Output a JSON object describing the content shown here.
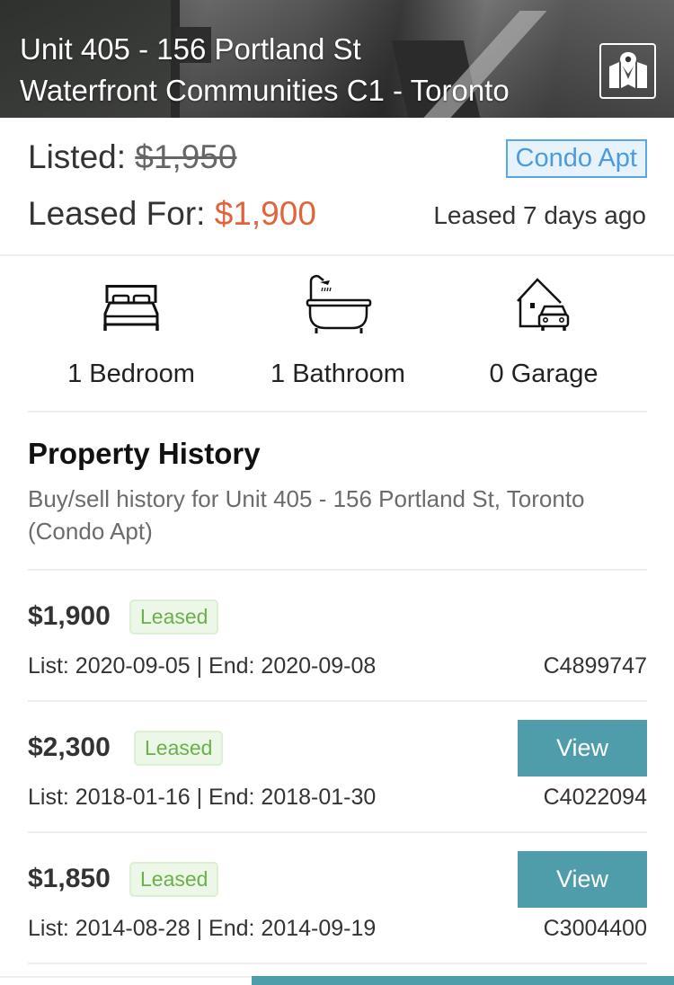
{
  "header": {
    "address_line": "Unit 405 - 156 Portland St",
    "community_line": "Waterfront Communities C1 - Toronto",
    "map_icon": "map-pin-icon"
  },
  "pricing": {
    "listed_label": "Listed:",
    "listed_price": "$1,950",
    "leased_label": "Leased For:",
    "leased_price": "$1,900",
    "property_type": "Condo Apt",
    "leased_ago": "Leased 7 days ago",
    "colors": {
      "leased_price": "#e2633a",
      "type_badge": "#4a9be0"
    }
  },
  "features": [
    {
      "icon": "bed-icon",
      "label": "1 Bedroom"
    },
    {
      "icon": "bathtub-icon",
      "label": "1 Bathroom"
    },
    {
      "icon": "garage-icon",
      "label": "0 Garage"
    }
  ],
  "history": {
    "title": "Property History",
    "subtitle": "Buy/sell history for Unit 405 - 156 Portland St, Toronto (Condo Apt)",
    "rows": [
      {
        "price": "$1,900",
        "status": "Leased",
        "dates": "List: 2020-09-05 | End: 2020-09-08",
        "mls": "C4899747",
        "view_label": null
      },
      {
        "price": "$2,300",
        "status": "Leased",
        "dates": "List: 2018-01-16 | End: 2018-01-30",
        "mls": "C4022094",
        "view_label": "View"
      },
      {
        "price": "$1,850",
        "status": "Leased",
        "dates": "List: 2014-08-28 | End: 2014-09-19",
        "mls": "C3004400",
        "view_label": "View"
      }
    ],
    "colors": {
      "status": "#6ab04c",
      "view_button": "#4f9dab"
    }
  }
}
